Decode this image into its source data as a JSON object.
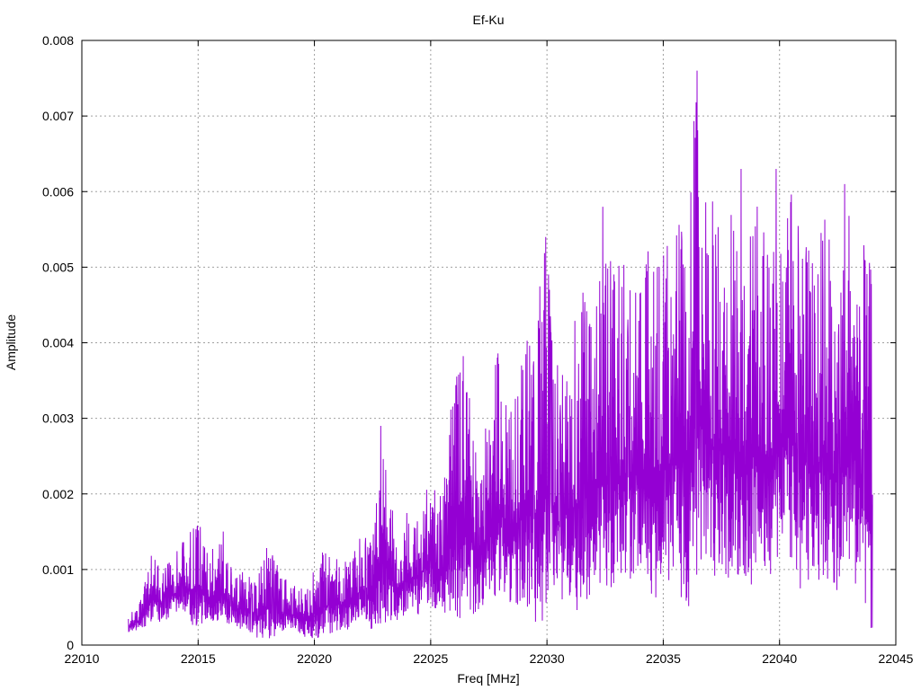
{
  "chart_data": {
    "type": "line",
    "title": "Ef-Ku",
    "xlabel": "Freq [MHz]",
    "ylabel": "Amplitude",
    "xlim": [
      22010,
      22045
    ],
    "ylim": [
      0,
      0.008
    ],
    "xticks": [
      "22010",
      "22015",
      "22020",
      "22025",
      "22030",
      "22035",
      "22040",
      "22045"
    ],
    "yticks": [
      "0",
      "0.001",
      "0.002",
      "0.003",
      "0.004",
      "0.005",
      "0.006",
      "0.007",
      "0.008"
    ],
    "grid": true,
    "line_color": "#9400d3",
    "x_range": [
      22012.0,
      22044.0
    ],
    "series": [
      {
        "x": [
          22012.0,
          22012.5,
          22013.0,
          22013.5,
          22014.0,
          22014.5,
          22015.0,
          22015.5,
          22016.0,
          22016.5,
          22017.0,
          22017.5,
          22018.0,
          22018.5,
          22019.0,
          22019.5,
          22020.0,
          22020.5,
          22021.0,
          22021.5,
          22022.0,
          22022.5,
          22023.0,
          22023.5,
          22024.0,
          22024.5,
          22025.0,
          22025.5,
          22026.0,
          22026.5,
          22027.0,
          22027.5,
          22028.0,
          22028.5,
          22029.0,
          22029.5,
          22030.0,
          22030.5,
          22031.0,
          22031.5,
          22032.0,
          22032.5,
          22033.0,
          22033.5,
          22034.0,
          22034.5,
          22035.0,
          22035.5,
          22036.0,
          22036.5,
          22037.0,
          22037.5,
          22038.0,
          22038.5,
          22039.0,
          22039.5,
          22040.0,
          22040.5,
          22041.0,
          22041.5,
          22042.0,
          22042.5,
          22043.0,
          22043.5,
          22044.0
        ],
        "y_low": [
          0.00015,
          0.0002,
          0.0003,
          0.0003,
          0.0004,
          0.0003,
          0.0002,
          0.0003,
          0.0002,
          0.0002,
          0.0002,
          0.0001,
          5e-05,
          0.0001,
          0.0002,
          0.0001,
          5e-05,
          0.0001,
          0.0002,
          0.0002,
          0.0003,
          0.0002,
          0.0003,
          0.0003,
          0.0004,
          0.0004,
          0.0005,
          0.0003,
          0.0003,
          0.0004,
          0.0004,
          0.0006,
          0.0006,
          0.0005,
          0.0005,
          0.0003,
          0.0002,
          0.0005,
          0.0006,
          0.0003,
          0.0008,
          0.0006,
          0.0005,
          0.0008,
          0.001,
          0.0005,
          0.0008,
          0.0008,
          0.0004,
          0.0009,
          0.0008,
          0.0009,
          0.0008,
          0.0006,
          0.0009,
          0.0007,
          0.0009,
          0.0009,
          0.0006,
          0.0009,
          0.0007,
          0.0007,
          0.001,
          0.0006,
          0.0001
        ],
        "y_high": [
          0.0004,
          0.0006,
          0.0012,
          0.001,
          0.0012,
          0.0015,
          0.0018,
          0.0012,
          0.0017,
          0.001,
          0.001,
          0.0008,
          0.0014,
          0.001,
          0.0008,
          0.0008,
          0.0011,
          0.0013,
          0.0012,
          0.0011,
          0.0015,
          0.0014,
          0.0029,
          0.0015,
          0.0018,
          0.0018,
          0.0024,
          0.0021,
          0.0035,
          0.004,
          0.0025,
          0.0032,
          0.0041,
          0.003,
          0.0043,
          0.0044,
          0.0054,
          0.0036,
          0.004,
          0.0049,
          0.0047,
          0.0051,
          0.0052,
          0.005,
          0.0049,
          0.0054,
          0.0052,
          0.0055,
          0.0059,
          0.0076,
          0.006,
          0.0058,
          0.0063,
          0.0057,
          0.0059,
          0.0054,
          0.0063,
          0.0062,
          0.0059,
          0.005,
          0.006,
          0.0046,
          0.0061,
          0.0054,
          0.005
        ]
      }
    ],
    "peaks": [
      {
        "x": 22022.85,
        "y": 0.0029
      },
      {
        "x": 22029.95,
        "y": 0.0054
      },
      {
        "x": 22032.4,
        "y": 0.0058
      },
      {
        "x": 22036.45,
        "y": 0.0076
      },
      {
        "x": 22038.35,
        "y": 0.0063
      },
      {
        "x": 22039.85,
        "y": 0.0063
      },
      {
        "x": 22042.8,
        "y": 0.0061
      }
    ]
  }
}
